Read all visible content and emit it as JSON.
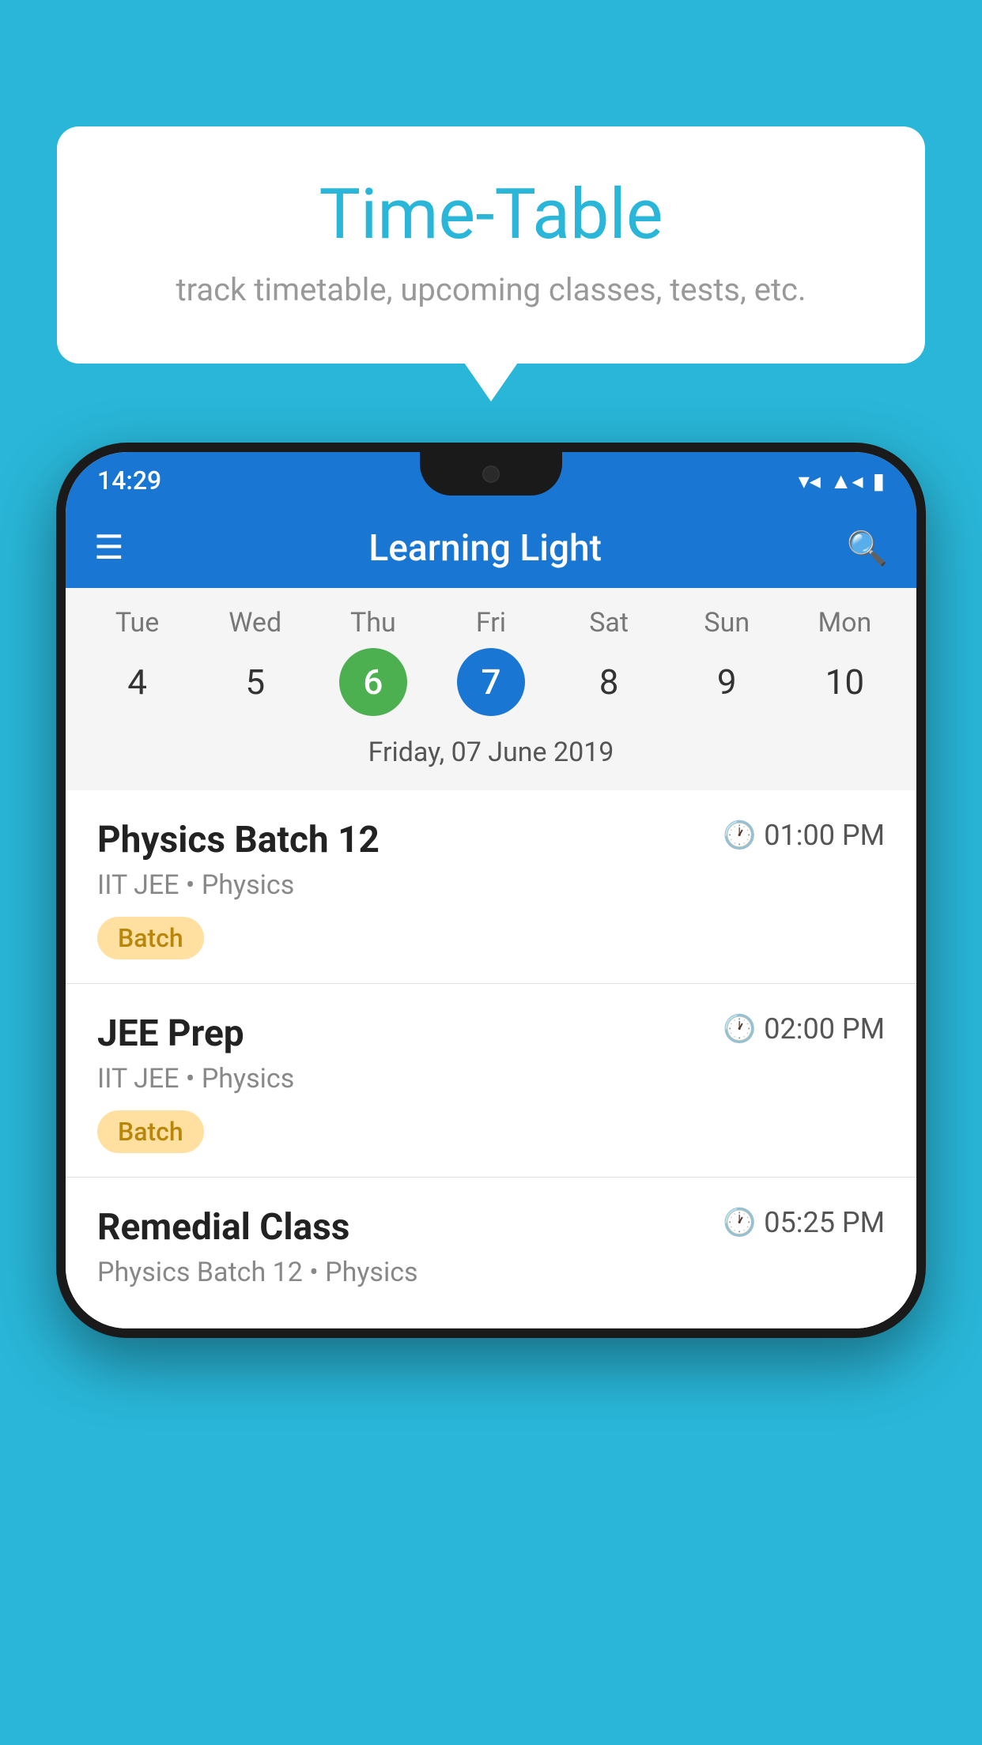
{
  "background_color": "#29B6D8",
  "speech_bubble": {
    "title": "Time-Table",
    "subtitle": "track timetable, upcoming classes, tests, etc."
  },
  "phone": {
    "status_bar": {
      "time": "14:29"
    },
    "app_bar": {
      "title": "Learning Light"
    },
    "calendar": {
      "days": [
        {
          "label": "Tue",
          "number": "4",
          "state": "normal"
        },
        {
          "label": "Wed",
          "number": "5",
          "state": "normal"
        },
        {
          "label": "Thu",
          "number": "6",
          "state": "today"
        },
        {
          "label": "Fri",
          "number": "7",
          "state": "selected"
        },
        {
          "label": "Sat",
          "number": "8",
          "state": "normal"
        },
        {
          "label": "Sun",
          "number": "9",
          "state": "normal"
        },
        {
          "label": "Mon",
          "number": "10",
          "state": "normal"
        }
      ],
      "selected_date_label": "Friday, 07 June 2019"
    },
    "schedule_items": [
      {
        "title": "Physics Batch 12",
        "time": "01:00 PM",
        "subtitle": "IIT JEE • Physics",
        "badge": "Batch"
      },
      {
        "title": "JEE Prep",
        "time": "02:00 PM",
        "subtitle": "IIT JEE • Physics",
        "badge": "Batch"
      },
      {
        "title": "Remedial Class",
        "time": "05:25 PM",
        "subtitle": "Physics Batch 12 • Physics",
        "badge": null
      }
    ]
  }
}
